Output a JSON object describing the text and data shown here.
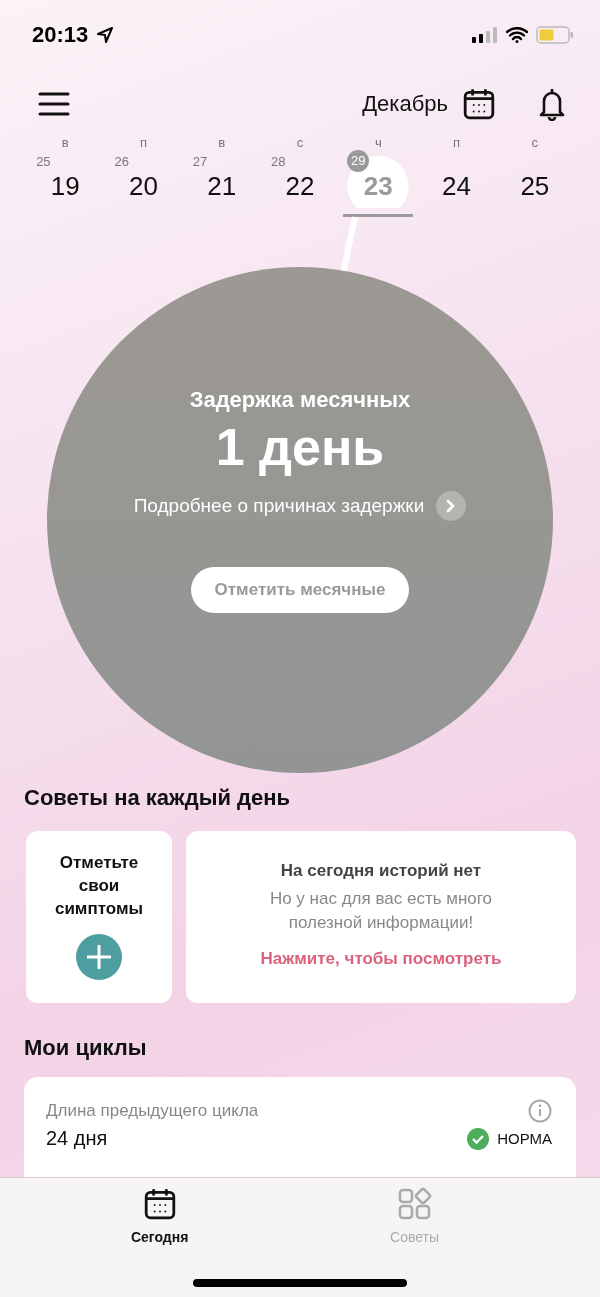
{
  "status_bar": {
    "time": "20:13"
  },
  "header": {
    "month": "Декабрь"
  },
  "days": [
    {
      "weekday": "в",
      "cycle_day": "25",
      "date": "19",
      "selected": false
    },
    {
      "weekday": "п",
      "cycle_day": "26",
      "date": "20",
      "selected": false
    },
    {
      "weekday": "в",
      "cycle_day": "27",
      "date": "21",
      "selected": false
    },
    {
      "weekday": "с",
      "cycle_day": "28",
      "date": "22",
      "selected": false
    },
    {
      "weekday": "ч",
      "cycle_day": "29",
      "date": "23",
      "selected": true
    },
    {
      "weekday": "п",
      "date": "24",
      "selected": false
    },
    {
      "weekday": "с",
      "date": "25",
      "selected": false
    }
  ],
  "status_circle": {
    "title": "Задержка месячных",
    "value": "1 день",
    "link": "Подробнее о причинах задержки",
    "button": "Отметить месячные"
  },
  "tips": {
    "title": "Советы на каждый день",
    "symptoms_card": {
      "label": "Отметьте свои симптомы"
    },
    "stories_card": {
      "title": "На сегодня историй нет",
      "text": "Но у нас для вас есть много полезной информации!",
      "link": "Нажмите, чтобы посмотреть"
    }
  },
  "cycles": {
    "title": "Мои циклы",
    "card": {
      "label": "Длина предыдущего цикла",
      "value": "24 дня",
      "status": "НОРМА"
    }
  },
  "tab_bar": [
    {
      "label": "Сегодня",
      "kind": "calendar",
      "selected": true
    },
    {
      "label": "Советы",
      "kind": "grid",
      "selected": false
    }
  ]
}
